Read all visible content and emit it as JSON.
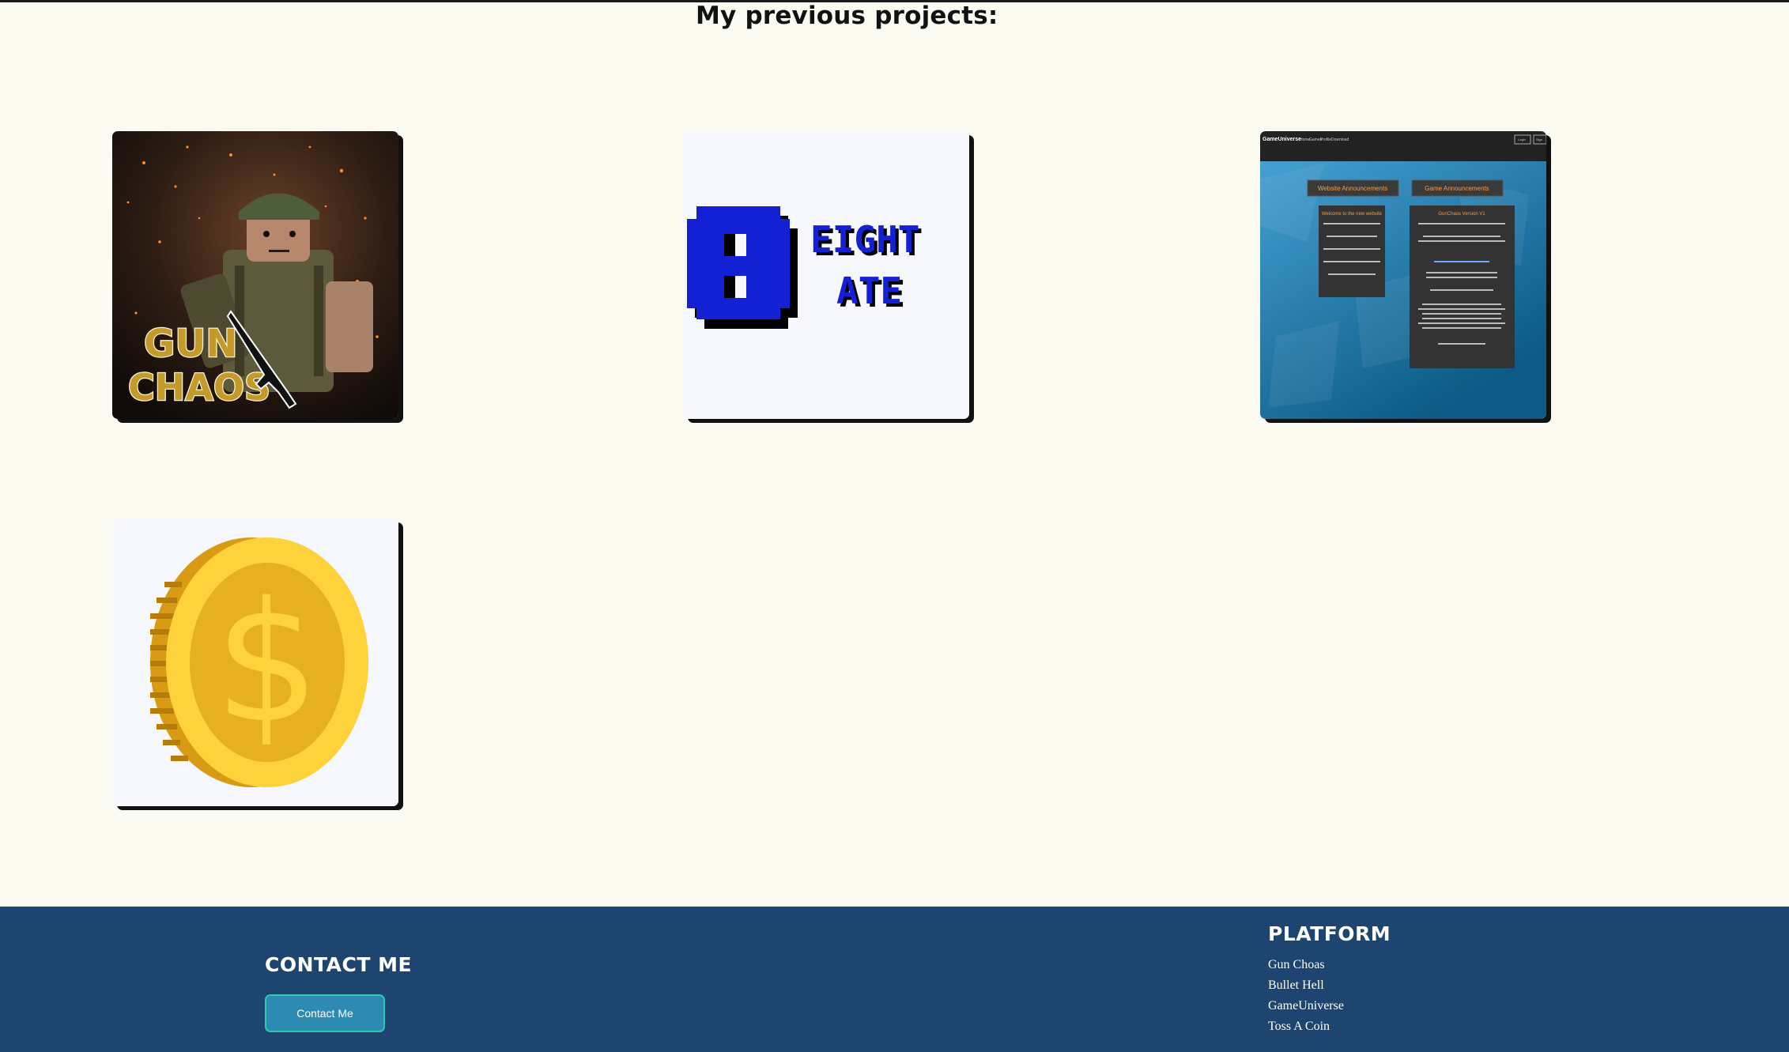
{
  "page": {
    "heading": "My previous projects:"
  },
  "projects": [
    {
      "id": "gun-chaos",
      "logo_text_line1": "GUN",
      "logo_text_line2": "CHAOS"
    },
    {
      "id": "eight-ate",
      "logo_big_char": "8",
      "logo_word1": "EIGHT",
      "logo_word2": "ATE",
      "color": "#1420d4"
    },
    {
      "id": "game-universe",
      "site_name": "GameUniverse",
      "nav": [
        "Home",
        "Games",
        "Profile",
        "Download"
      ],
      "buttons": [
        "Login",
        "Sign"
      ],
      "tab1": "Website Announcements",
      "tab2": "Game Announcements",
      "panel1_title": "Welcome to the new website",
      "panel2_title": "GunChaos Version V1"
    },
    {
      "id": "toss-a-coin",
      "symbol": "$",
      "color": "#e6b01e"
    }
  ],
  "footer": {
    "contact_heading": "CONTACT ME",
    "contact_button": "Contact Me",
    "platform_heading": "PLATFORM",
    "platform_links": [
      "Gun Choas",
      "Bullet Hell",
      "GameUniverse",
      "Toss A Coin"
    ]
  },
  "colors": {
    "background": "#fcfbf1",
    "footer": "#1d4570",
    "button": "#2c8ab3",
    "button_border": "#2ec9b0"
  }
}
